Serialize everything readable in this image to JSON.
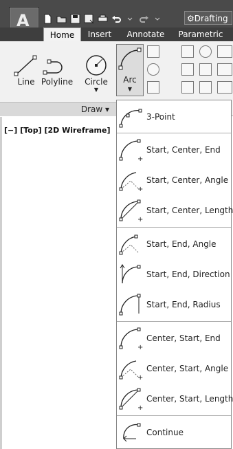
{
  "quick_access": {
    "workspace_label": "Drafting"
  },
  "ribbon": {
    "tabs": [
      "Home",
      "Insert",
      "Annotate",
      "Parametric"
    ],
    "tools": [
      "Line",
      "Polyline",
      "Circle",
      "Arc"
    ],
    "panel_label": "Draw ▾"
  },
  "viewport": {
    "label": "[−] [Top] [2D Wireframe]"
  },
  "arc_menu": {
    "items": [
      "3-Point",
      "Start, Center, End",
      "Start, Center, Angle",
      "Start, Center, Length",
      "Start, End, Angle",
      "Start, End, Direction",
      "Start, End, Radius",
      "Center, Start, End",
      "Center, Start, Angle",
      "Center, Start, Length",
      "Continue"
    ]
  }
}
